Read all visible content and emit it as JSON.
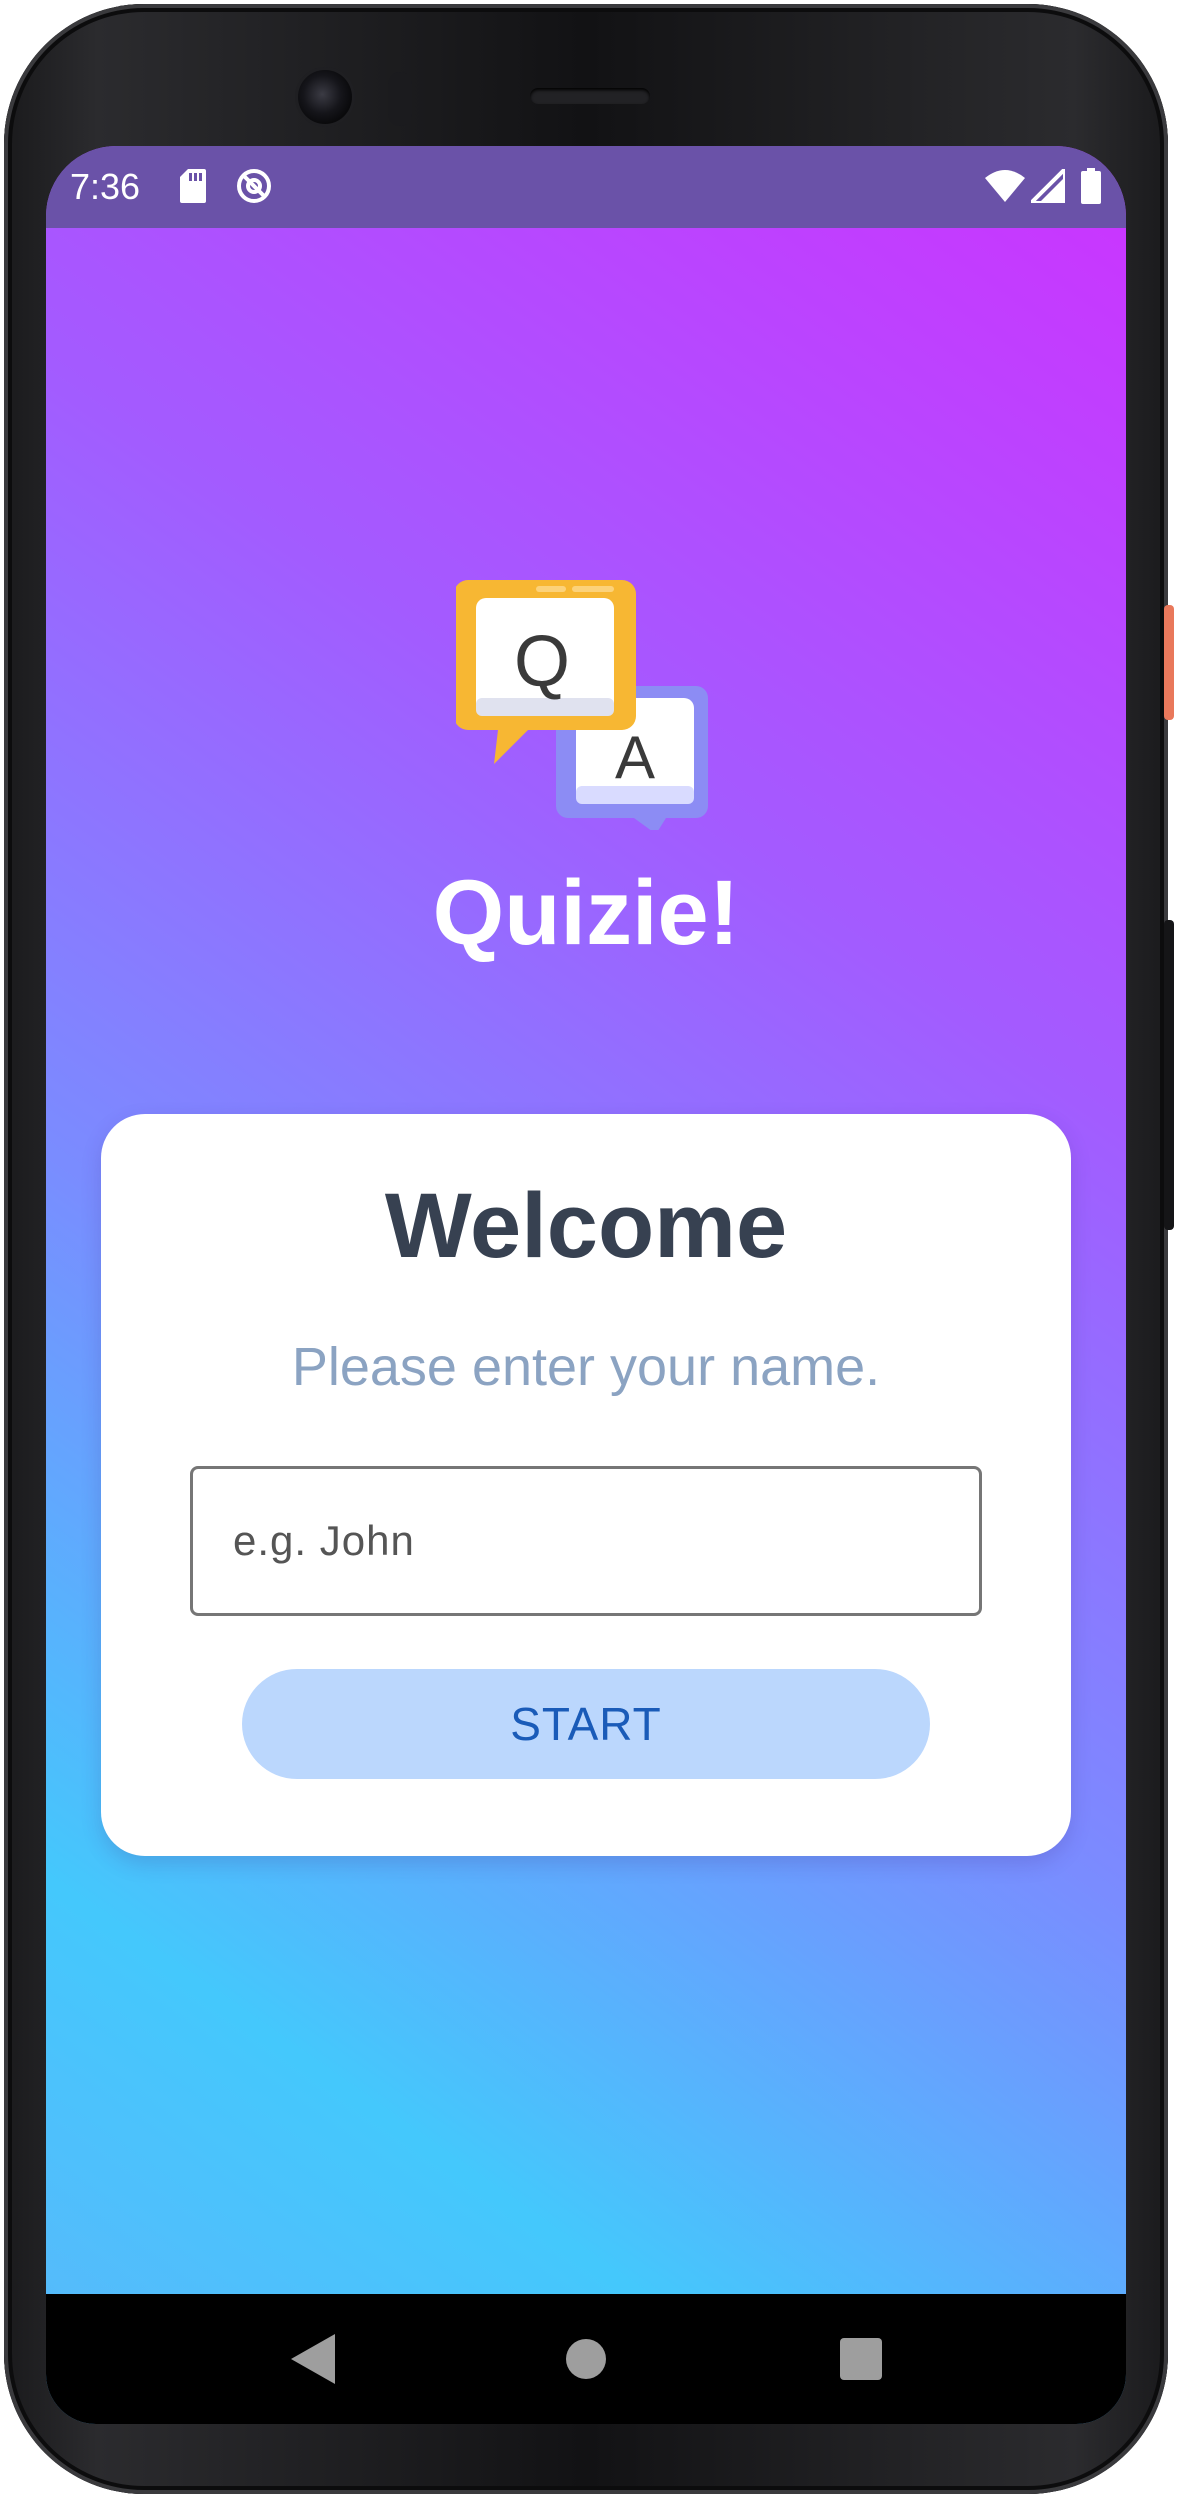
{
  "status_bar": {
    "time": "7:36",
    "icons": [
      "sd-card-icon",
      "do-not-disturb-icon",
      "wifi-icon",
      "cellular-signal-icon",
      "battery-icon"
    ]
  },
  "app": {
    "title": "Quizie!",
    "logo": {
      "question_letter": "Q",
      "answer_letter": "A",
      "colors": {
        "question_bubble": "#f7b733",
        "answer_bubble": "#8c8cf4"
      }
    }
  },
  "card": {
    "title": "Welcome",
    "subtitle": "Please enter your name.",
    "name_input": {
      "placeholder": "e.g. John",
      "value": ""
    },
    "start_label": "START"
  },
  "nav_bar": {
    "buttons": [
      "back-icon",
      "home-icon",
      "recents-icon"
    ]
  },
  "colors": {
    "gradient_top": "#cc33ff",
    "gradient_bottom": "#44c8fc",
    "status_bar": "#6a52a8",
    "card_title": "#374151",
    "subtitle": "#8ba3c2",
    "button_bg": "#bbd7fd",
    "button_text": "#1a5bb8"
  }
}
